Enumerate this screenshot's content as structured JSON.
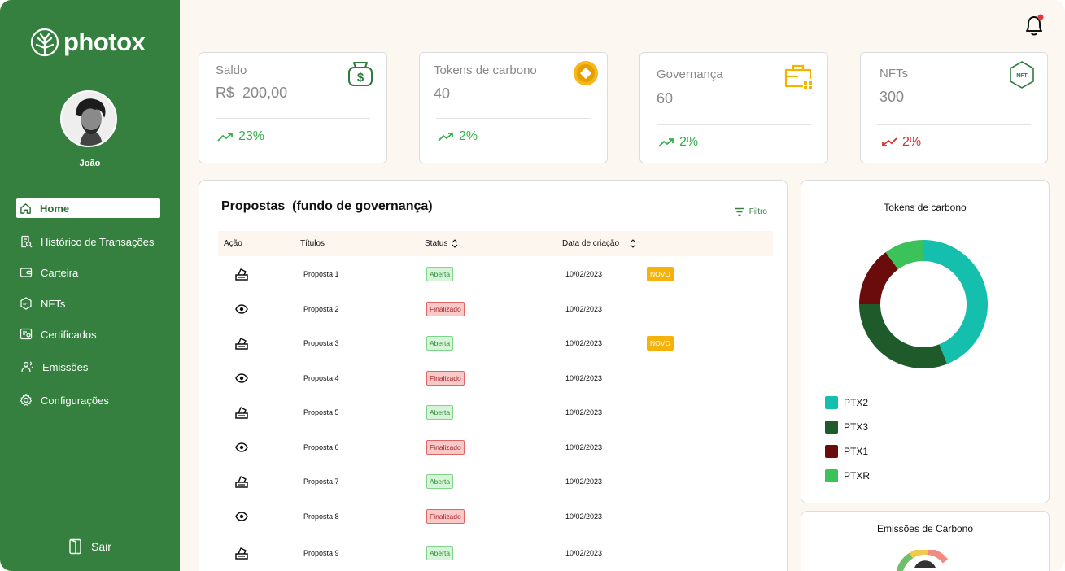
{
  "app": {
    "brand": "photox",
    "user_name": "João"
  },
  "sidebar": {
    "items": [
      {
        "label": "Home",
        "icon": "home-icon",
        "active": true
      },
      {
        "label": "Histórico de Transações",
        "icon": "receipt-search-icon"
      },
      {
        "label": "Carteira",
        "icon": "wallet-icon"
      },
      {
        "label": "NFTs",
        "icon": "nft-hexagon-icon"
      },
      {
        "label": "Certificados",
        "icon": "certificate-icon"
      },
      {
        "label": "Emissões",
        "icon": "emissions-icon"
      },
      {
        "label": "Configurações",
        "icon": "gear-icon"
      }
    ],
    "logout_label": "Sair"
  },
  "stats": [
    {
      "label": "Saldo",
      "currency": "R$",
      "value": "200,00",
      "trend": "23%",
      "direction": "up",
      "icon": "money-bag-icon"
    },
    {
      "label": "Tokens de carbono",
      "value": "40",
      "trend": "2%",
      "direction": "up",
      "icon": "coin-icon"
    },
    {
      "label": "Governança",
      "value": "60",
      "trend": "2%",
      "direction": "up",
      "icon": "briefcase-icon"
    },
    {
      "label": "NFTs",
      "value": "300",
      "trend": "2%",
      "direction": "down",
      "icon": "nft-hexagon-icon",
      "icon_text": "NFT"
    }
  ],
  "proposals": {
    "title": "Propostas  (fundo de governança)",
    "filter_label": "Filtro",
    "columns": {
      "action": "Ação",
      "title": "Títulos",
      "status": "Status",
      "date": "Data de criação"
    },
    "rows": [
      {
        "action": "vote",
        "title": "Proposta 1",
        "status": "Aberta",
        "date": "10/02/2023",
        "tag": "NOVO"
      },
      {
        "action": "view",
        "title": "Proposta 2",
        "status": "Finalizado",
        "date": "10/02/2023",
        "tag": ""
      },
      {
        "action": "vote",
        "title": "Proposta 3",
        "status": "Aberta",
        "date": "10/02/2023",
        "tag": "NOVO"
      },
      {
        "action": "view",
        "title": "Proposta 4",
        "status": "Finalizado",
        "date": "10/02/2023",
        "tag": ""
      },
      {
        "action": "vote",
        "title": "Proposta 5",
        "status": "Aberta",
        "date": "10/02/2023",
        "tag": ""
      },
      {
        "action": "view",
        "title": "Proposta 6",
        "status": "Finalizado",
        "date": "10/02/2023",
        "tag": ""
      },
      {
        "action": "vote",
        "title": "Proposta 7",
        "status": "Aberta",
        "date": "10/02/2023",
        "tag": ""
      },
      {
        "action": "view",
        "title": "Proposta 8",
        "status": "Finalizado",
        "date": "10/02/2023",
        "tag": ""
      },
      {
        "action": "vote",
        "title": "Proposta 9",
        "status": "Aberta",
        "date": "10/02/2023",
        "tag": ""
      }
    ]
  },
  "tokens_chart": {
    "title": "Tokens de carbono",
    "slices": [
      {
        "name": "PTX2",
        "value": 44,
        "color": "#14bfae"
      },
      {
        "name": "PTX3",
        "value": 31,
        "color": "#1f5a2b"
      },
      {
        "name": "PTX1",
        "value": 15,
        "color": "#6b0c0c"
      },
      {
        "name": "PTXR",
        "value": 10,
        "color": "#3cc25a"
      }
    ]
  },
  "emissions_chart": {
    "title": "Emissões de Carbono"
  },
  "colors": {
    "sidebar": "#35803f",
    "background": "#fcf7f1",
    "up": "#35b04d",
    "down": "#d93030",
    "novo": "#f5b20b"
  }
}
